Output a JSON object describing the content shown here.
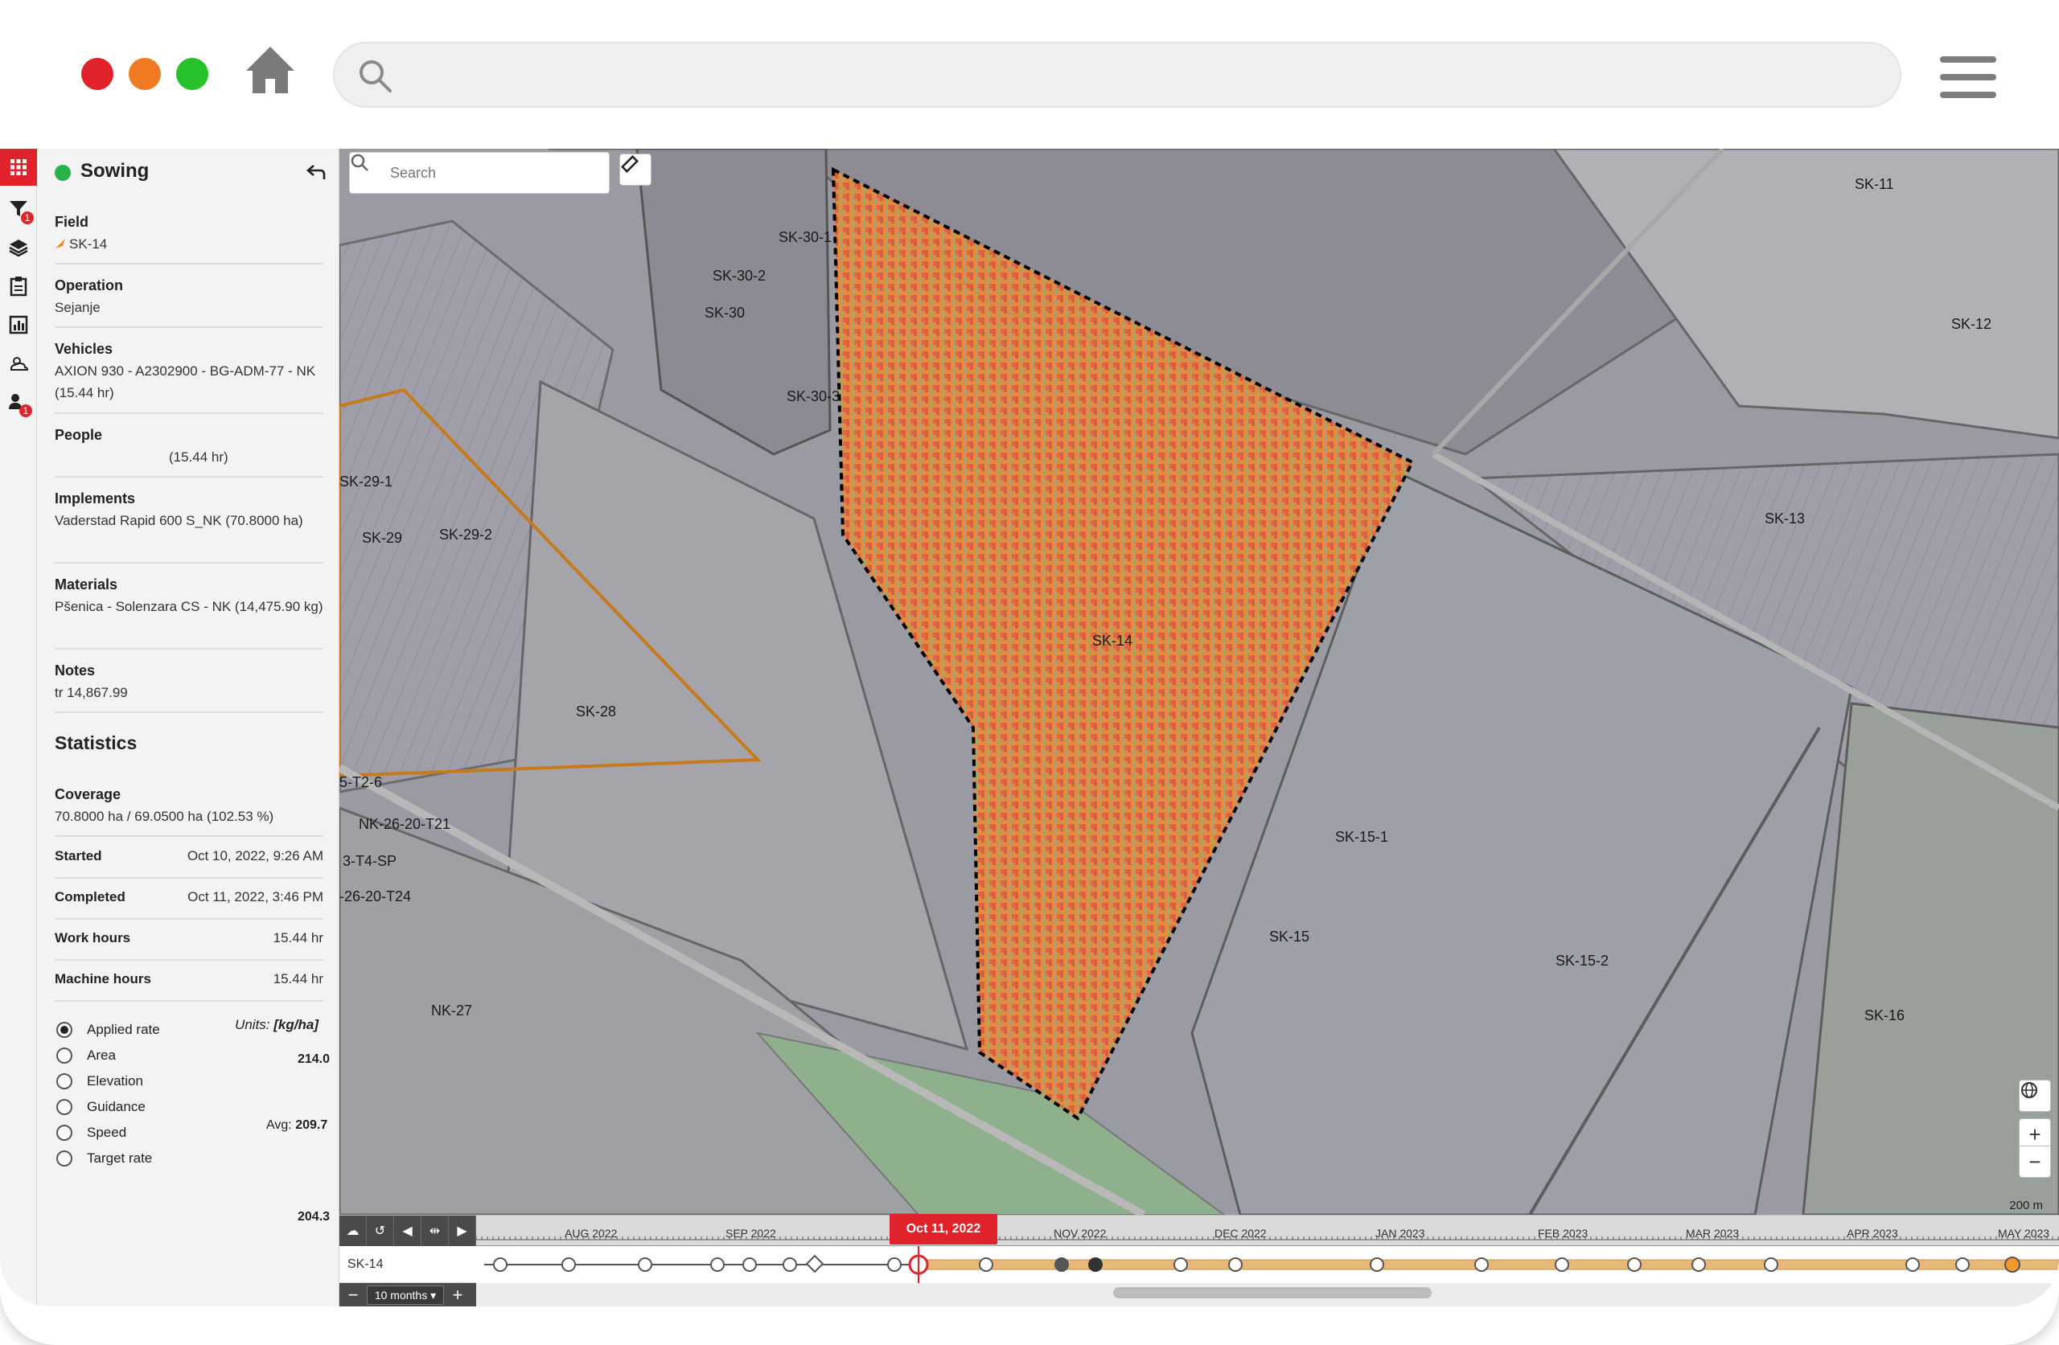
{
  "browser": {
    "search_placeholder": ""
  },
  "panel": {
    "title": "Sowing",
    "sections": [
      {
        "label": "Field",
        "value": "SK-14"
      },
      {
        "label": "Operation",
        "value": "Sejanje"
      },
      {
        "label": "Vehicles",
        "value": "AXION 930 - A2302900 - BG-ADM-77 - NK (15.44 hr)"
      },
      {
        "label": "People",
        "value": "(15.44 hr)"
      },
      {
        "label": "Implements",
        "value": "Vaderstad Rapid 600 S_NK (70.8000 ha)"
      },
      {
        "label": "Materials",
        "value": "Pšenica - Solenzara CS - NK (14,475.90 kg)"
      },
      {
        "label": "Notes",
        "value": "tr 14,867.99"
      }
    ],
    "statistics_heading": "Statistics",
    "coverage_label": "Coverage",
    "coverage_value": "70.8000 ha / 69.0500 ha (102.53 %)",
    "stats": [
      {
        "label": "Started",
        "value": "Oct 10, 2022, 9:26 AM"
      },
      {
        "label": "Completed",
        "value": "Oct 11, 2022, 3:46 PM"
      },
      {
        "label": "Work hours",
        "value": "15.44 hr"
      },
      {
        "label": "Machine hours",
        "value": "15.44 hr"
      }
    ],
    "layers": [
      "Applied rate",
      "Area",
      "Elevation",
      "Guidance",
      "Speed",
      "Target rate"
    ],
    "selected_layer": "Applied rate",
    "legend": {
      "units_label": "Units:",
      "units_value": "[kg/ha]",
      "max": "214.0",
      "avg_label": "Avg:",
      "avg": "209.7",
      "min": "204.3"
    },
    "badges": {
      "filter": "1",
      "people": "1"
    }
  },
  "map": {
    "search_placeholder": "Search",
    "scale_label": "200 m",
    "field_labels": [
      "SK-30-1",
      "SK-30-2",
      "SK-30",
      "SK-30-3",
      "SK-29-1",
      "SK-29",
      "SK-29-2",
      "SK-28",
      "5-T2-6",
      "NK-26-20-T21",
      "3-T4-SP",
      "-26-20-T24",
      "NK-27",
      "SK-14",
      "SK-11",
      "SK-12",
      "SK-13",
      "SK-15-1",
      "SK-15",
      "SK-15-2",
      "SK-16"
    ]
  },
  "timeline": {
    "field": "SK-14",
    "current_date": "Oct 11, 2022",
    "zoom": "10 months",
    "months": [
      "AUG 2022",
      "SEP 2022",
      "NOV 2022",
      "DEC 2022",
      "JAN 2023",
      "FEB 2023",
      "MAR 2023",
      "APR 2023",
      "MAY 2023"
    ]
  },
  "colors": {
    "brand_red": "#e0232a",
    "status_green": "#27b24a",
    "track_orange": "#e9b877"
  }
}
